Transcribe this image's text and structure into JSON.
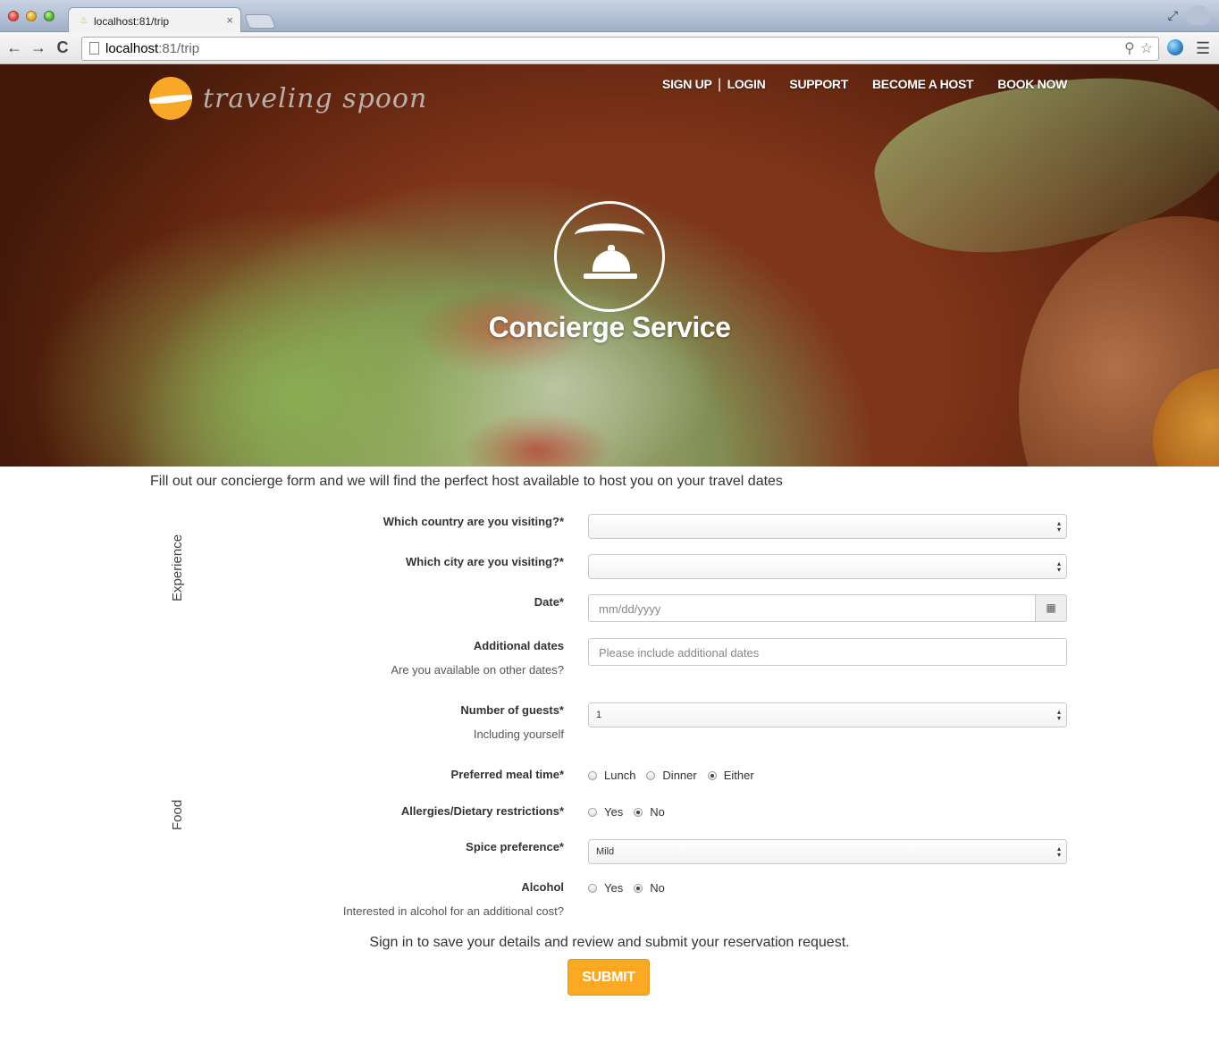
{
  "browser": {
    "tab_title": "localhost:81/trip",
    "tab_close": "×",
    "url_host": "localhost",
    "url_rest": ":81/trip",
    "back": "←",
    "forward": "→",
    "reload": "C",
    "search_glyph": "⚲",
    "star_glyph": "☆",
    "menu_glyph": "☰",
    "fullscreen_glyph": "⤢"
  },
  "site": {
    "logo_text": "traveling spoon",
    "nav": {
      "signup": "SIGN UP",
      "separator": "|",
      "login": "LOGIN",
      "support": "SUPPORT",
      "become_host": "BECOME A HOST",
      "book_now": "BOOK NOW"
    },
    "hero_title": "Concierge Service",
    "brand_color": "#fba823"
  },
  "form": {
    "intro": "Fill out our concierge form and we will find the perfect host available to host you on your travel dates",
    "section_experience": "Experience",
    "section_food": "Food",
    "country_label": "Which country are you visiting?*",
    "country_value": "",
    "city_label": "Which city are you visiting?*",
    "city_value": "",
    "date_label": "Date*",
    "date_placeholder": "mm/dd/yyyy",
    "calendar_glyph": "▦",
    "additional_label": "Additional dates",
    "additional_sublabel": "Are you available on other dates?",
    "additional_placeholder": "Please include additional dates",
    "guests_label": "Number of guests*",
    "guests_sublabel": "Including yourself",
    "guests_value": "1",
    "meal_label": "Preferred meal time*",
    "meal_options": [
      "Lunch",
      "Dinner",
      "Either"
    ],
    "meal_selected": "Either",
    "allergies_label": "Allergies/Dietary restrictions*",
    "allergies_options": [
      "Yes",
      "No"
    ],
    "allergies_selected": "No",
    "spice_label": "Spice preference*",
    "spice_value": "Mild",
    "alcohol_label": "Alcohol",
    "alcohol_sublabel": "Interested in alcohol for an additional cost?",
    "alcohol_options": [
      "Yes",
      "No"
    ],
    "alcohol_selected": "No",
    "select_arrows": "▲▼",
    "signin_note": "Sign in to save your details and review and submit your reservation request.",
    "submit_label": "SUBMIT"
  }
}
